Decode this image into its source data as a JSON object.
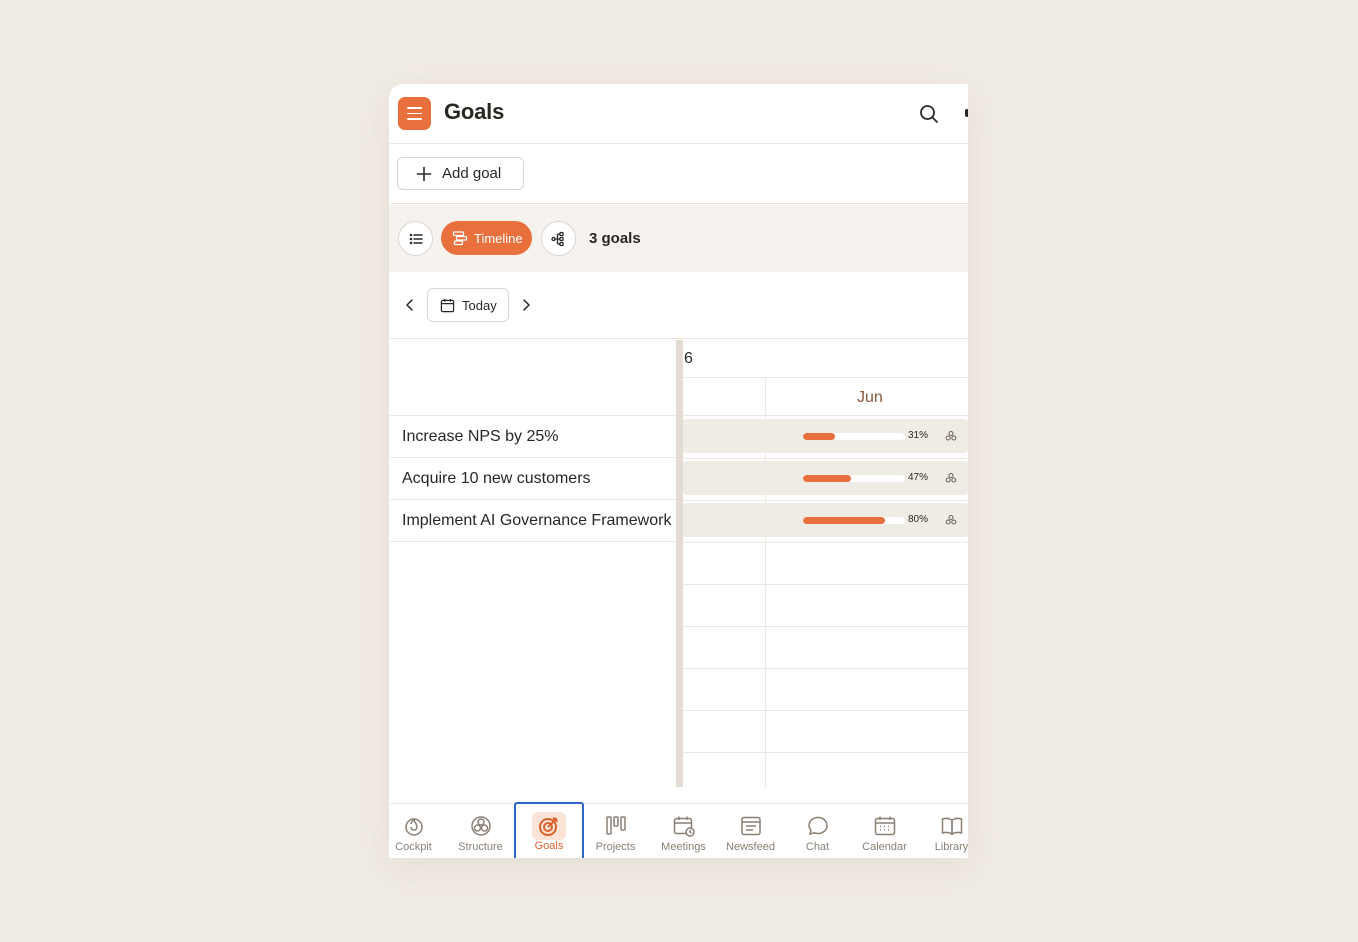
{
  "header": {
    "title": "Goals",
    "menu_icon": "menu-icon",
    "search_icon": "search-icon"
  },
  "toolbar": {
    "add_goal_label": "Add goal"
  },
  "views": {
    "timeline_label": "Timeline",
    "goal_count": "3 goals"
  },
  "date_nav": {
    "today_label": "Today"
  },
  "timeline": {
    "year_label": "6",
    "month_label": "Jun"
  },
  "goals": [
    {
      "title": "Increase NPS by 25%",
      "progress": 31,
      "progress_label": "31%"
    },
    {
      "title": "Acquire 10 new customers",
      "progress": 47,
      "progress_label": "47%"
    },
    {
      "title": "Implement AI Governance Framework",
      "progress": 80,
      "progress_label": "80%"
    }
  ],
  "nav": [
    {
      "label": "Cockpit",
      "icon": "cockpit-icon"
    },
    {
      "label": "Structure",
      "icon": "structure-icon"
    },
    {
      "label": "Goals",
      "icon": "goals-icon",
      "active": true
    },
    {
      "label": "Projects",
      "icon": "projects-icon"
    },
    {
      "label": "Meetings",
      "icon": "meetings-icon"
    },
    {
      "label": "Newsfeed",
      "icon": "newsfeed-icon"
    },
    {
      "label": "Chat",
      "icon": "chat-icon"
    },
    {
      "label": "Calendar",
      "icon": "calendar-icon"
    },
    {
      "label": "Library",
      "icon": "library-icon"
    }
  ],
  "colors": {
    "accent": "#e8703c",
    "active_outline": "#2f63c9",
    "background": "#f1ece4"
  }
}
